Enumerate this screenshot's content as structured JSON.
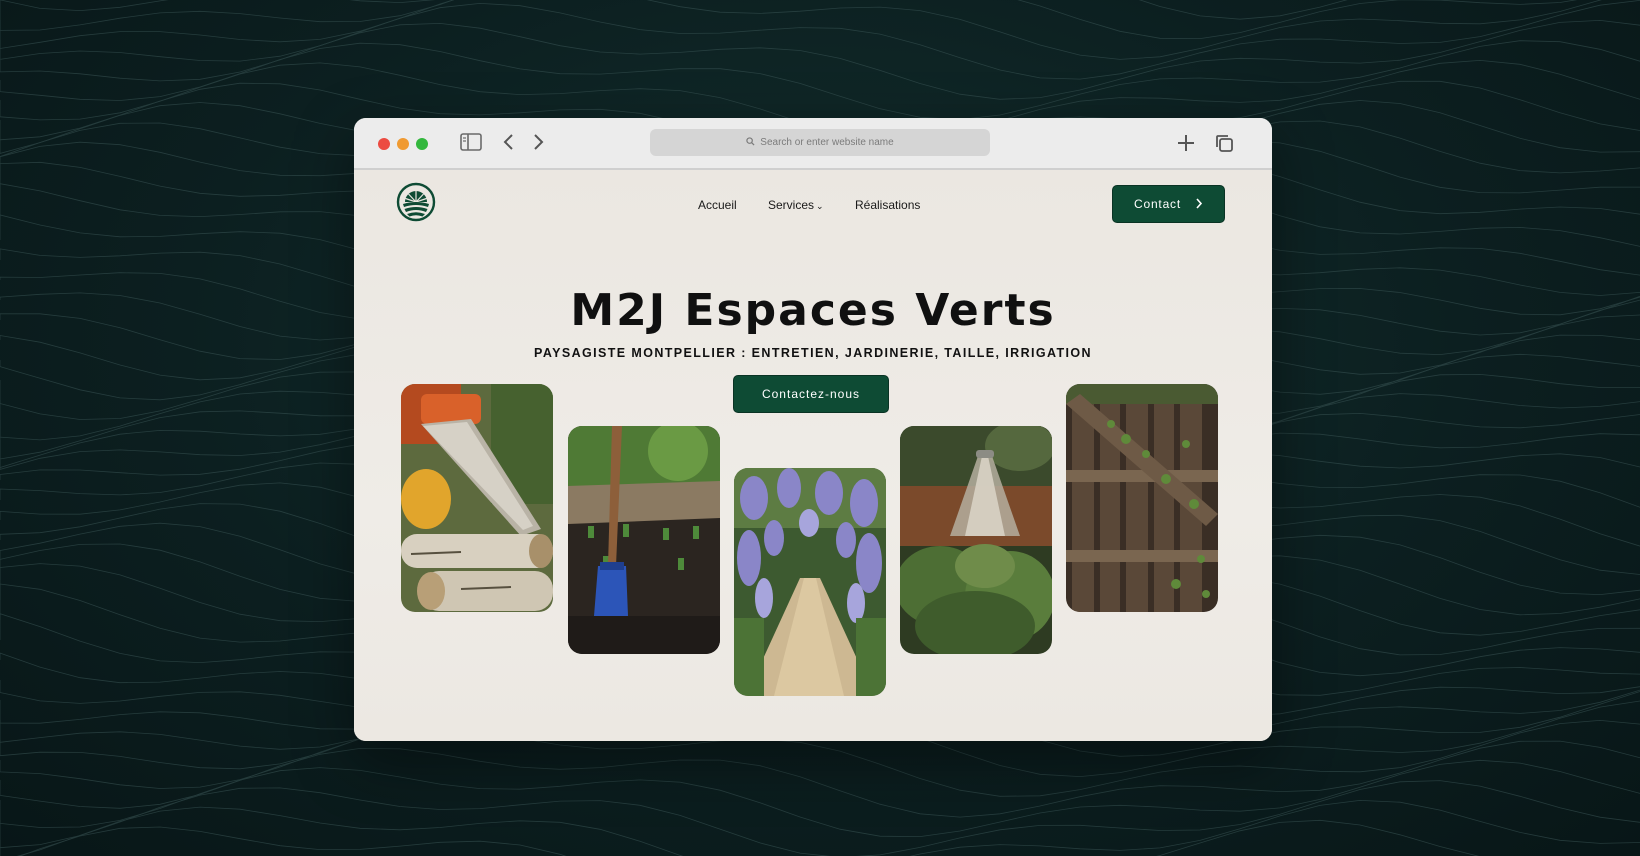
{
  "browser": {
    "url_placeholder": "Search or enter website name",
    "icons": [
      "sidebar-icon",
      "back-arrow-icon",
      "forward-arrow-icon",
      "search-icon",
      "new-tab-icon",
      "tabs-overview-icon"
    ]
  },
  "site": {
    "nav": {
      "items": [
        {
          "label": "Accueil"
        },
        {
          "label": "Services"
        },
        {
          "label": "Réalisations"
        }
      ],
      "contact_label": "Contact"
    },
    "hero": {
      "title": "M2J Espaces Verts",
      "subtitle": "PAYSAGISTE MONTPELLIER : ENTRETIEN, JARDINERIE, TAILLE, IRRIGATION",
      "cta_label": "Contactez-nous"
    },
    "photos": [
      {
        "subject": "chainsaw cutting logs"
      },
      {
        "subject": "spade in garden soil"
      },
      {
        "subject": "wisteria garden path"
      },
      {
        "subject": "watering can over plants"
      },
      {
        "subject": "wooden gate with vines"
      }
    ]
  },
  "colors": {
    "accent": "#0e4b34",
    "page_bg": "#ebe7e1",
    "backdrop": "#0c1f20"
  }
}
